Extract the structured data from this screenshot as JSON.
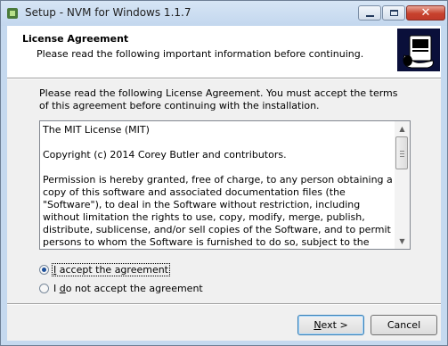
{
  "window": {
    "title": "Setup - NVM for Windows 1.1.7"
  },
  "header": {
    "title": "License Agreement",
    "subtitle": "Please read the following important information before continuing."
  },
  "intro": "Please read the following License Agreement. You must accept the terms of this agreement before continuing with the installation.",
  "license_text": "The MIT License (MIT)\n\nCopyright (c) 2014 Corey Butler and contributors.\n\nPermission is hereby granted, free of charge, to any person obtaining a copy of this software and associated documentation files (the \"Software\"), to deal in the Software without restriction, including without limitation the rights to use, copy, modify, merge, publish, distribute, sublicense, and/or sell copies of the Software, and to permit persons to whom the Software is furnished to do so, subject to the following conditions:",
  "options": {
    "accept": {
      "prefix": "",
      "accesskey": "I",
      "rest": " accept the agreement",
      "selected": true
    },
    "decline": {
      "prefix": "I ",
      "accesskey": "d",
      "rest": "o not accept the agreement",
      "selected": false
    }
  },
  "buttons": {
    "next": {
      "accesskey": "N",
      "rest": "ext >"
    },
    "cancel": "Cancel"
  },
  "colors": {
    "title_bar": "#c3d7ee",
    "close_button": "#c7422d",
    "dialog_bg": "#f0f0f0",
    "radio_dot": "#1c4f9a"
  }
}
